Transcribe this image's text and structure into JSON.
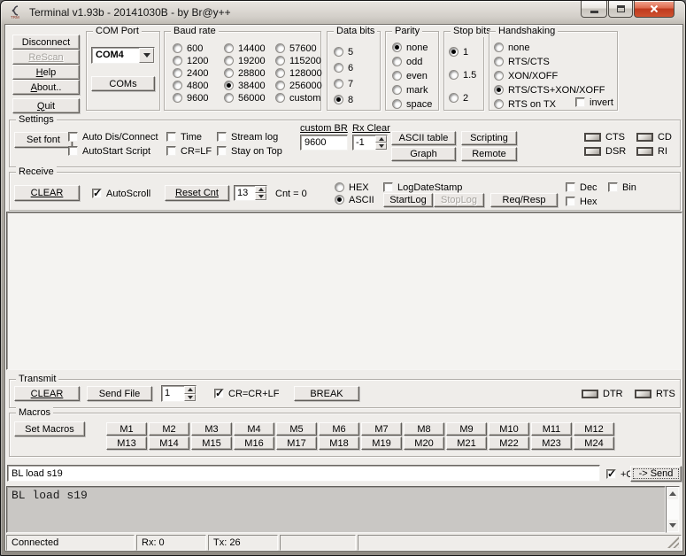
{
  "window": {
    "title": "Terminal v1.93b - 20141030B - by Br@y++"
  },
  "actions": {
    "disconnect": "Disconnect",
    "rescan": "ReScan",
    "help": "Help",
    "about": "About..",
    "quit": "Quit"
  },
  "com_port": {
    "label": "COM Port",
    "selected": "COM4",
    "coms": "COMs"
  },
  "baud": {
    "label": "Baud rate",
    "col1": [
      "600",
      "1200",
      "2400",
      "4800",
      "9600"
    ],
    "col2": [
      "14400",
      "19200",
      "28800",
      "38400",
      "56000"
    ],
    "col3": [
      "57600",
      "115200",
      "128000",
      "256000",
      "custom"
    ],
    "selected": "38400"
  },
  "data_bits": {
    "label": "Data bits",
    "options": [
      "5",
      "6",
      "7",
      "8"
    ],
    "selected": "8"
  },
  "parity": {
    "label": "Parity",
    "options": [
      "none",
      "odd",
      "even",
      "mark",
      "space"
    ],
    "selected": "none"
  },
  "stop_bits": {
    "label": "Stop bits",
    "options": [
      "1",
      "1.5",
      "2"
    ],
    "selected": "1"
  },
  "handshaking": {
    "label": "Handshaking",
    "options": [
      "none",
      "RTS/CTS",
      "XON/XOFF",
      "RTS/CTS+XON/XOFF",
      "RTS on TX"
    ],
    "selected": "RTS/CTS+XON/XOFF",
    "invert": "invert",
    "invert_checked": false
  },
  "settings": {
    "label": "Settings",
    "set_font": "Set font",
    "checkboxes": {
      "auto_dis_connect": "Auto Dis/Connect",
      "autostart_script": "AutoStart Script",
      "time": "Time",
      "cr_lf": "CR=LF",
      "stream_log": "Stream log",
      "stay_on_top": "Stay on Top"
    },
    "custom_br": {
      "label": "custom BR",
      "value": "9600"
    },
    "rx_clear": {
      "label": "Rx Clear",
      "value": "-1"
    },
    "buttons": {
      "ascii_table": "ASCII table",
      "scripting": "Scripting",
      "graph": "Graph",
      "remote": "Remote"
    },
    "leds": {
      "cts": "CTS",
      "dsr": "DSR",
      "cd": "CD",
      "ri": "RI"
    }
  },
  "receive": {
    "label": "Receive",
    "clear": "CLEAR",
    "autoscroll": "AutoScroll",
    "autoscroll_checked": true,
    "reset_cnt": "Reset Cnt",
    "counter": "13",
    "cnt": "Cnt = 0",
    "modes": [
      "HEX",
      "ASCII"
    ],
    "mode_selected": "ASCII",
    "log_datestamp": "LogDateStamp",
    "startlog": "StartLog",
    "stoplog": "StopLog",
    "req_resp": "Req/Resp",
    "view_flags": {
      "dec": "Dec",
      "hex": "Hex",
      "bin": "Bin"
    },
    "content": ""
  },
  "transmit": {
    "label": "Transmit",
    "clear": "CLEAR",
    "send_file": "Send File",
    "count": "1",
    "cr_crlf": "CR=CR+LF",
    "cr_crlf_checked": true,
    "break": "BREAK",
    "leds": {
      "dtr": "DTR",
      "rts": "RTS"
    }
  },
  "macros": {
    "label": "Macros",
    "set_macros": "Set Macros",
    "row1": [
      "M1",
      "M2",
      "M3",
      "M4",
      "M5",
      "M6",
      "M7",
      "M8",
      "M9",
      "M10",
      "M11",
      "M12"
    ],
    "row2": [
      "M13",
      "M14",
      "M15",
      "M16",
      "M17",
      "M18",
      "M19",
      "M20",
      "M21",
      "M22",
      "M23",
      "M24"
    ]
  },
  "tx_line": {
    "value": "BL load s19",
    "cr": "+CR",
    "cr_checked": true,
    "send": "-> Send"
  },
  "tx_history": {
    "content": "BL load s19"
  },
  "status_bar": {
    "connection": "Connected",
    "rx": "Rx: 0",
    "tx": "Tx: 26"
  },
  "colors": {
    "close_button": "#bf3a1e",
    "client_bg": "#efedea",
    "rx_display_bg": "#f4f3f1",
    "tx_history_bg": "#c9c7c4"
  }
}
